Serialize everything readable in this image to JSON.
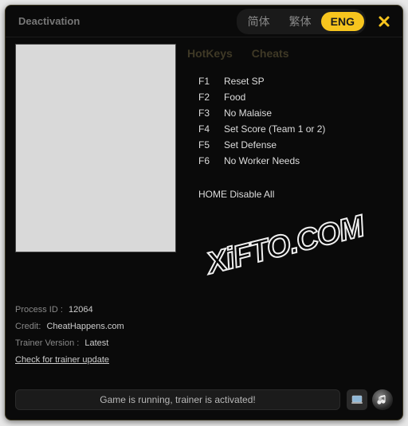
{
  "window": {
    "title": "Deactivation"
  },
  "languages": {
    "items": [
      {
        "label": "简体",
        "active": false
      },
      {
        "label": "繁体",
        "active": false
      },
      {
        "label": "ENG",
        "active": true
      }
    ]
  },
  "tabs": {
    "hotkeys": "HotKeys",
    "cheats": "Cheats"
  },
  "hotkeys": [
    {
      "key": "F1",
      "desc": "Reset SP"
    },
    {
      "key": "F2",
      "desc": "Food"
    },
    {
      "key": "F3",
      "desc": "No Malaise"
    },
    {
      "key": "F4",
      "desc": "Set Score (Team 1 or 2)"
    },
    {
      "key": "F5",
      "desc": "Set Defense"
    },
    {
      "key": "F6",
      "desc": "No Worker Needs"
    }
  ],
  "disable_all": {
    "key": "HOME",
    "label": "Disable All"
  },
  "meta": {
    "process_id_label": "Process ID :",
    "process_id_value": "12064",
    "credit_label": "Credit:",
    "credit_value": "CheatHappens.com",
    "version_label": "Trainer Version :",
    "version_value": "Latest",
    "update_link": "Check for trainer update"
  },
  "status": {
    "text": "Game is running, trainer is activated!"
  },
  "watermark": "XiFTO.COM"
}
